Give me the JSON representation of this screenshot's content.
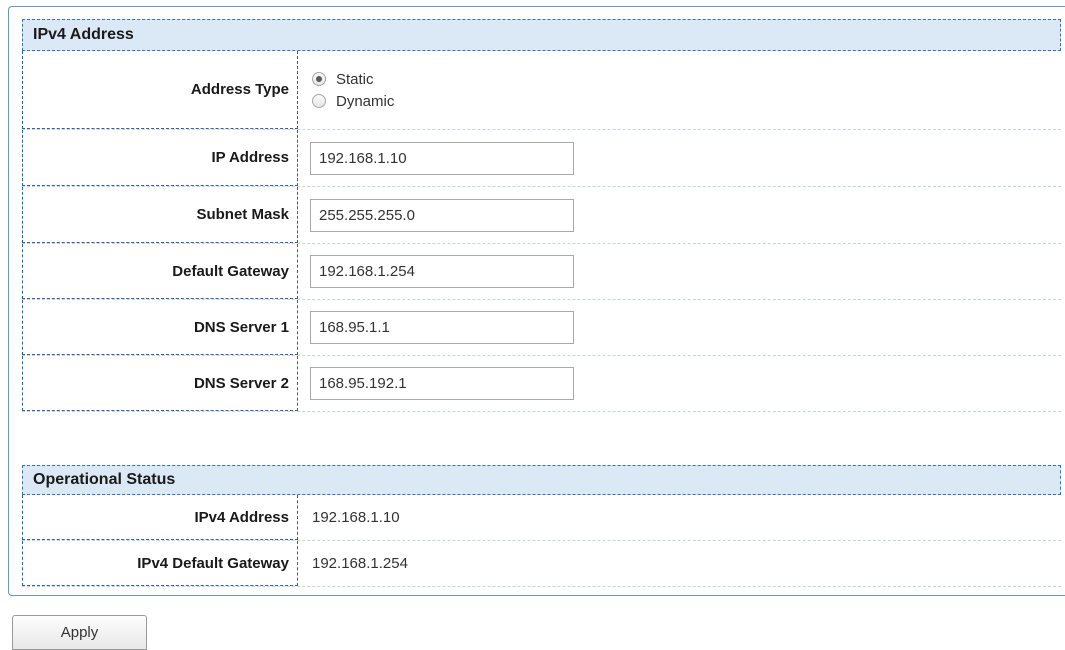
{
  "ipv4_section": {
    "title": "IPv4 Address",
    "address_type": {
      "label": "Address Type",
      "options": [
        "Static",
        "Dynamic"
      ],
      "selected": "Static"
    },
    "ip_address": {
      "label": "IP Address",
      "value": "192.168.1.10"
    },
    "subnet_mask": {
      "label": "Subnet Mask",
      "value": "255.255.255.0"
    },
    "default_gateway": {
      "label": "Default Gateway",
      "value": "192.168.1.254"
    },
    "dns_server_1": {
      "label": "DNS Server 1",
      "value": "168.95.1.1"
    },
    "dns_server_2": {
      "label": "DNS Server 2",
      "value": "168.95.192.1"
    }
  },
  "operational_status": {
    "title": "Operational Status",
    "ipv4_address": {
      "label": "IPv4 Address",
      "value": "192.168.1.10"
    },
    "ipv4_default_gateway": {
      "label": "IPv4 Default Gateway",
      "value": "192.168.1.254"
    }
  },
  "actions": {
    "apply_label": "Apply"
  }
}
